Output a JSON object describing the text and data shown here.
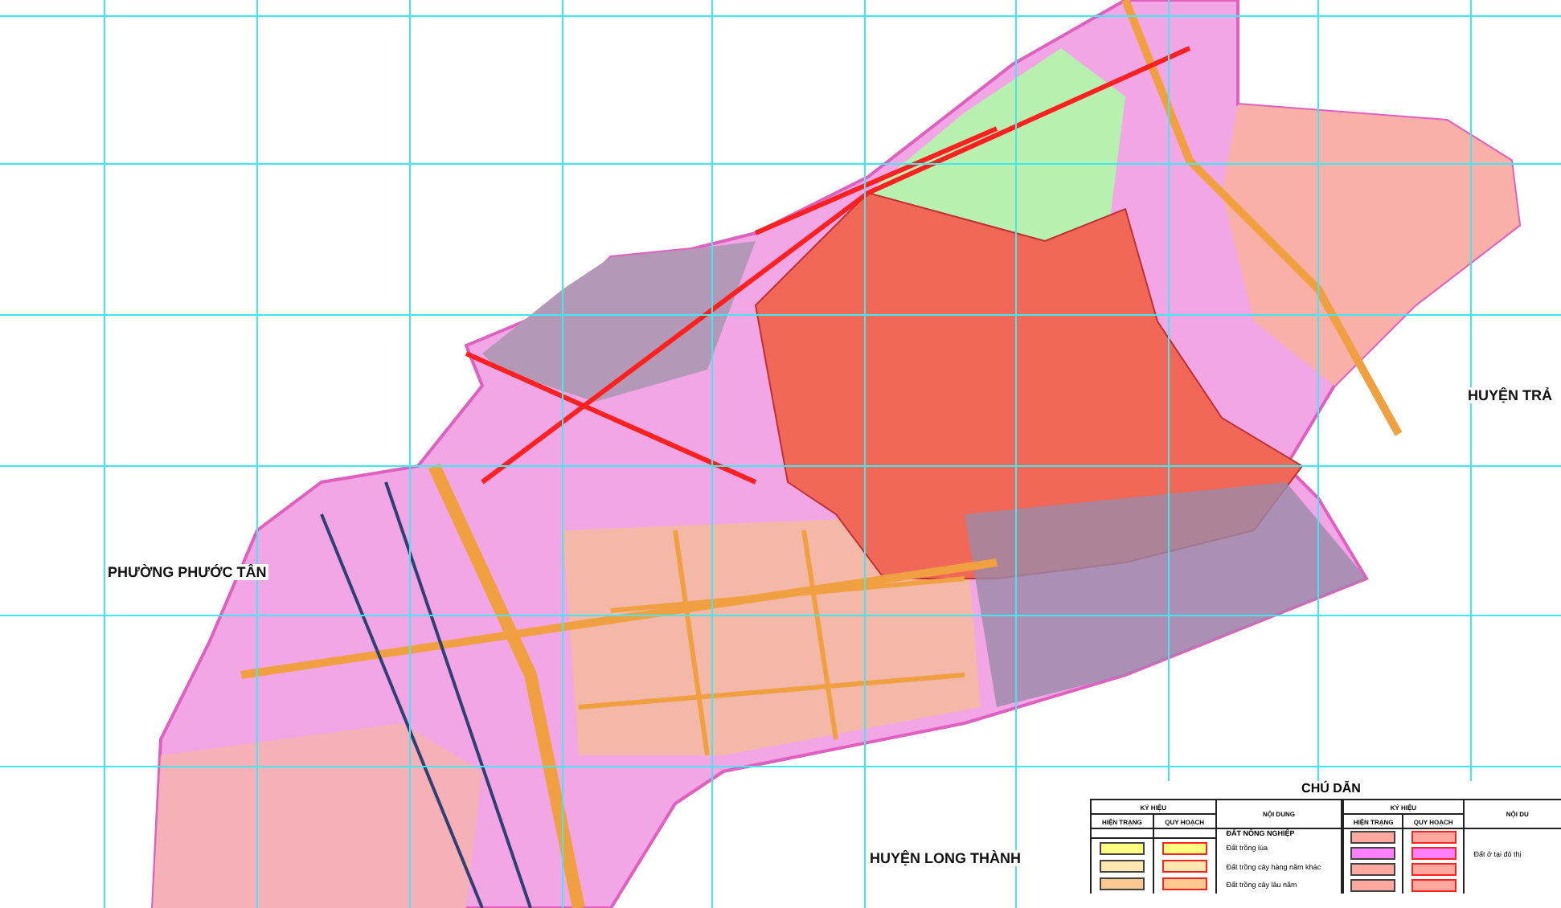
{
  "map": {
    "labels": [
      {
        "text": "PHƯỜNG PHƯỚC TÂN"
      },
      {
        "text": "HUYỆN TRẢ"
      },
      {
        "text": "HUYỆN LONG THÀNH"
      }
    ]
  },
  "legend": {
    "title": "CHÚ DẪN",
    "groups": [
      {
        "symbol_header": "KÝ HIỆU",
        "current_header": "HIỆN TRẠNG",
        "planned_header": "QUY HOẠCH",
        "content_header": "NỘI DUNG",
        "section": "ĐẤT NÔNG NGHIỆP",
        "rows": [
          {
            "color": "#ffff80",
            "text": "Đất trồng lúa"
          },
          {
            "color": "#ffe8b0",
            "text": "Đất trồng cây hàng năm khác"
          },
          {
            "color": "#ffc890",
            "text": "Đất trồng cây lâu năm"
          }
        ]
      },
      {
        "symbol_header": "KÝ HIỆU",
        "current_header": "HIỆN TRẠNG",
        "planned_header": "QUY HOẠCH",
        "content_header": "NỘI DU",
        "rows": [
          {
            "color": "#ffa8a0"
          },
          {
            "color": "#ff80ff",
            "text": "Đất ở tại đô thị"
          },
          {
            "color": "#ffa8a0"
          },
          {
            "color": "#ffa8a0"
          }
        ]
      }
    ]
  }
}
